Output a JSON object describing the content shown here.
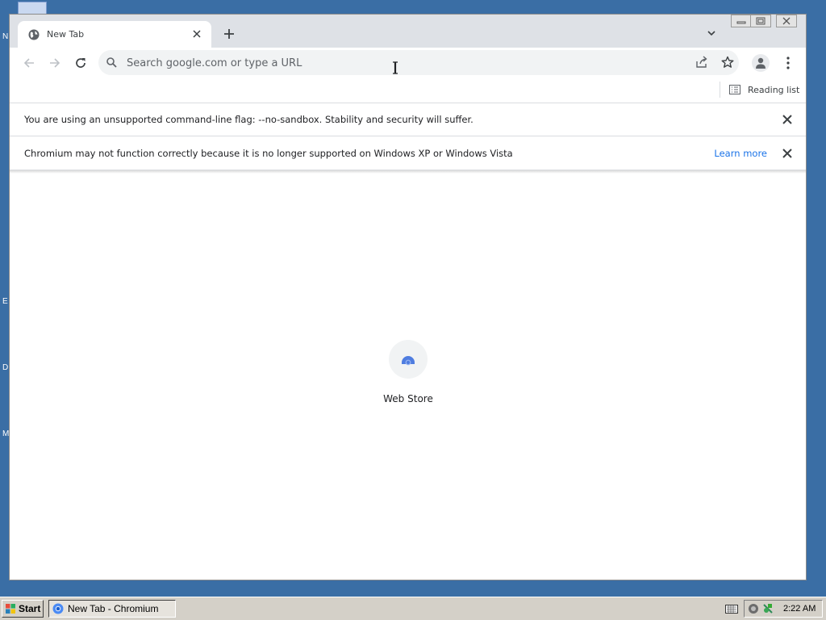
{
  "desktop": {
    "icon_letters": [
      "N",
      "E",
      "D",
      "M"
    ]
  },
  "tab": {
    "title": "New Tab",
    "favicon": "globe-icon"
  },
  "omnibox": {
    "placeholder": "Search google.com or type a URL",
    "value": ""
  },
  "bookmarks": {
    "reading_list_label": "Reading list"
  },
  "infobars": [
    {
      "message": "You are using an unsupported command-line flag: --no-sandbox. Stability and security will suffer."
    },
    {
      "message": "Chromium may not function correctly because it is no longer supported on Windows XP or Windows Vista",
      "link": "Learn more"
    }
  ],
  "shortcuts": [
    {
      "label": "Web Store",
      "icon": "web-store-icon"
    }
  ],
  "taskbar": {
    "start_label": "Start",
    "task_label": "New Tab - Chromium",
    "clock": "2:22 AM"
  },
  "colors": {
    "desktop": "#3a6ea5",
    "accent": "#1a73e8",
    "tabstrip": "#dee1e6"
  }
}
